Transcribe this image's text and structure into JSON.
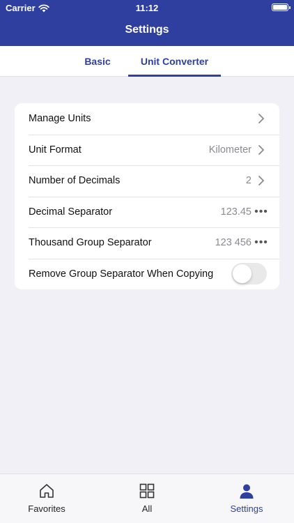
{
  "status_bar": {
    "carrier": "Carrier",
    "time": "11:12"
  },
  "header": {
    "title": "Settings"
  },
  "tabs": [
    {
      "label": "Basic",
      "active": false
    },
    {
      "label": "Unit Converter",
      "active": true
    }
  ],
  "settings": [
    {
      "label": "Manage Units",
      "value": "",
      "accessory": "chevron"
    },
    {
      "label": "Unit Format",
      "value": "Kilometer",
      "accessory": "chevron"
    },
    {
      "label": "Number of Decimals",
      "value": "2",
      "accessory": "chevron"
    },
    {
      "label": "Decimal Separator",
      "value": "123.45",
      "accessory": "more"
    },
    {
      "label": "Thousand Group Separator",
      "value": "123 456",
      "accessory": "more"
    },
    {
      "label": "Remove Group Separator When Copying",
      "toggle_on": false
    }
  ],
  "tabbar": [
    {
      "label": "Favorites",
      "icon": "home-icon",
      "active": false
    },
    {
      "label": "All",
      "icon": "grid-icon",
      "active": false
    },
    {
      "label": "Settings",
      "icon": "person-icon",
      "active": true
    }
  ],
  "colors": {
    "accent": "#2f3f9f",
    "background": "#f0f0f6",
    "secondary_text": "#8a8a90"
  }
}
